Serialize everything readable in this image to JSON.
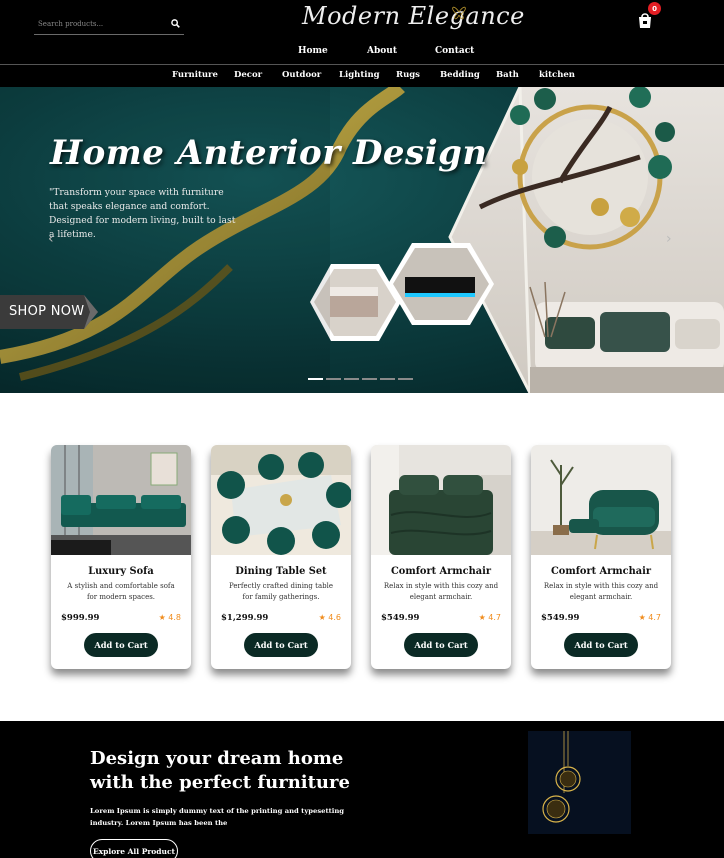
{
  "header": {
    "search": {
      "placeholder": "Search products..."
    },
    "logo": "Modern Elegance",
    "cart_count": "0",
    "nav": [
      "Home",
      "About",
      "Contact"
    ]
  },
  "categories": [
    "Furniture",
    "Decor",
    "Outdoor",
    "Lighting",
    "Rugs",
    "Bedding",
    "Bath",
    "kitchen"
  ],
  "hero": {
    "title": "Home Anterior Design",
    "description": "\"Transform your space with furniture that speaks elegance and comfort. Designed for modern living, built to last a lifetime.",
    "cta": "SHOP NOW",
    "prev_arrow": "‹",
    "next_arrow": "›",
    "slide_count": 6,
    "active_slide": 1
  },
  "products": [
    {
      "name": "Luxury Sofa",
      "description": "A stylish and comfortable sofa for modern spaces.",
      "price": "$999.99",
      "rating": "★ 4.8",
      "button": "Add to Cart"
    },
    {
      "name": "Dining Table Set",
      "description": "Perfectly crafted dining table for family gatherings.",
      "price": "$1,299.99",
      "rating": "★ 4.6",
      "button": "Add to Cart"
    },
    {
      "name": "Comfort Armchair",
      "description": "Relax in style with this cozy and elegant armchair.",
      "price": "$549.99",
      "rating": "★ 4.7",
      "button": "Add to Cart"
    },
    {
      "name": "Comfort Armchair",
      "description": "Relax in style with this cozy and elegant armchair.",
      "price": "$549.99",
      "rating": "★ 4.7",
      "button": "Add to Cart"
    }
  ],
  "promo": {
    "title": "Design your dream home with the perfect furniture",
    "description": "Lorem Ipsum is simply dummy text of the printing and typesetting industry. Lorem Ipsum has been the",
    "button": "Explore All Product"
  },
  "colors": {
    "header_bg": "#000000",
    "accent_dark_green": "#0b2a25",
    "hero_teal": "#0c3b3c",
    "rating_orange": "#f08c1d",
    "badge_red": "#e31e24",
    "gold": "#b8962e"
  },
  "icons": [
    "search-icon",
    "cart-icon",
    "chevron-left-icon",
    "chevron-right-icon",
    "star-icon"
  ]
}
